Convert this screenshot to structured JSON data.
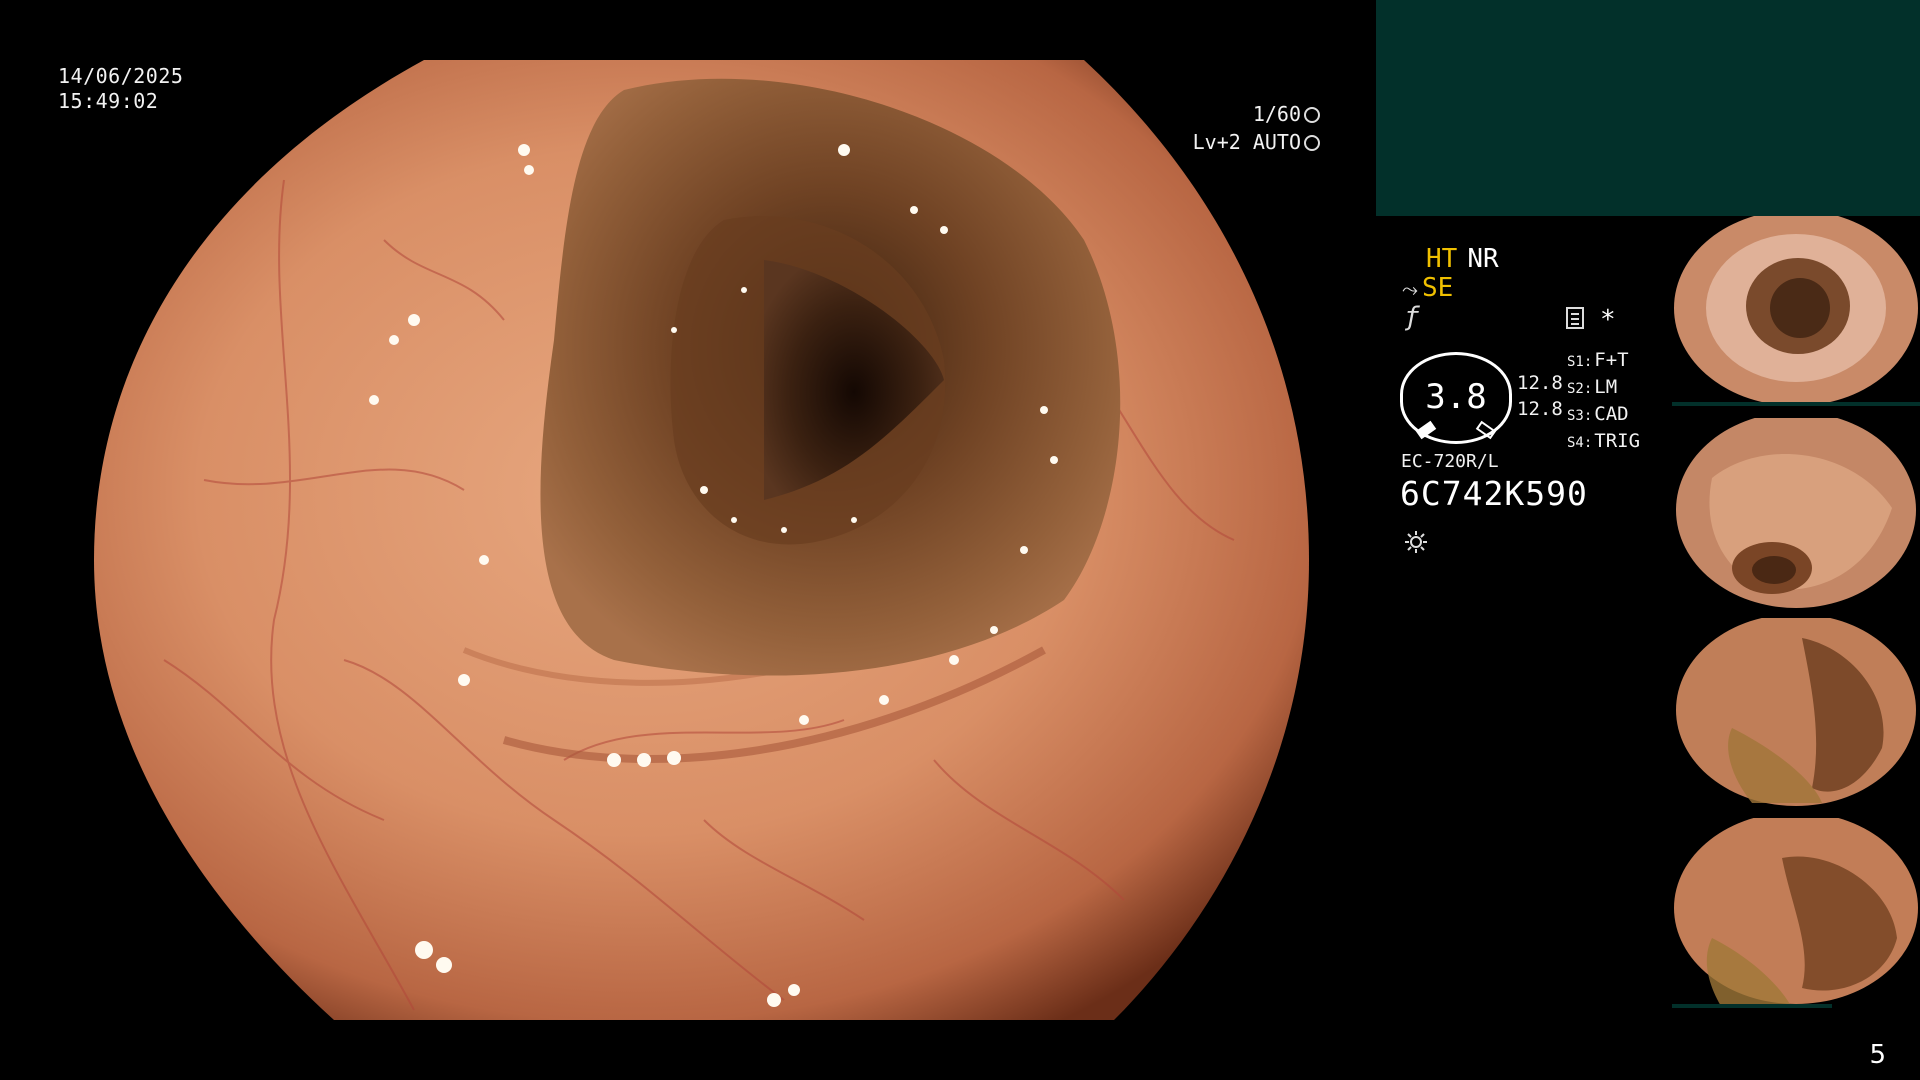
{
  "overlay": {
    "date": "14/06/2025",
    "time": "15:49:02",
    "shutter": "1/60",
    "level": "Lv+2 AUTO"
  },
  "panel": {
    "mode_ht": "HT",
    "mode_nr": "NR",
    "mode_se": "SE",
    "zoom_value": "3.8",
    "freq_values": [
      "12.8",
      "12.8"
    ],
    "switches": [
      {
        "key": "S1:",
        "value": "F+T"
      },
      {
        "key": "S2:",
        "value": "LM"
      },
      {
        "key": "S3:",
        "value": "CAD"
      },
      {
        "key": "S4:",
        "value": "TRIG"
      }
    ],
    "scope_model": "EC-720R/L",
    "scope_serial": "6C742K590",
    "star": "*"
  },
  "thumbnails": {
    "serial_label": "6C742K590"
  },
  "page": {
    "number": "5"
  },
  "colors": {
    "teal_panel": "#02302a",
    "mode_highlight": "#f0c000"
  },
  "icons": [
    "shutter-icon",
    "iris-icon",
    "scope-icon",
    "f-icon",
    "memory-icon",
    "light-icon"
  ]
}
